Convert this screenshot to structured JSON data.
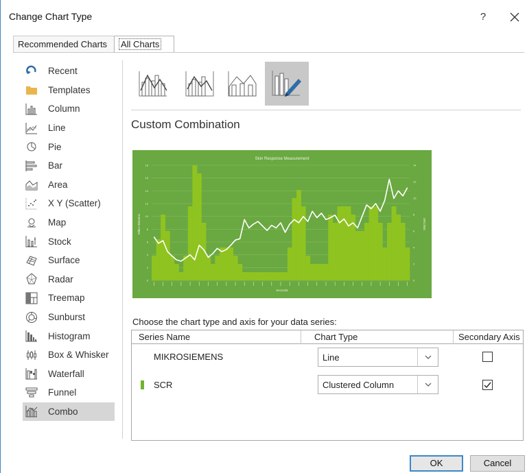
{
  "dialog": {
    "title": "Change Chart Type",
    "help": "?",
    "close": "✕"
  },
  "tabs": [
    {
      "label": "Recommended Charts"
    },
    {
      "label": "All Charts",
      "selected": true
    }
  ],
  "sidebar": {
    "items": [
      {
        "label": "Recent",
        "icon": "recent-icon"
      },
      {
        "label": "Templates",
        "icon": "templates-folder-icon"
      },
      {
        "label": "Column",
        "icon": "column-chart-icon"
      },
      {
        "label": "Line",
        "icon": "line-chart-icon"
      },
      {
        "label": "Pie",
        "icon": "pie-chart-icon"
      },
      {
        "label": "Bar",
        "icon": "bar-chart-icon"
      },
      {
        "label": "Area",
        "icon": "area-chart-icon"
      },
      {
        "label": "X Y (Scatter)",
        "icon": "scatter-chart-icon"
      },
      {
        "label": "Map",
        "icon": "map-chart-icon"
      },
      {
        "label": "Stock",
        "icon": "stock-chart-icon"
      },
      {
        "label": "Surface",
        "icon": "surface-chart-icon"
      },
      {
        "label": "Radar",
        "icon": "radar-chart-icon"
      },
      {
        "label": "Treemap",
        "icon": "treemap-chart-icon"
      },
      {
        "label": "Sunburst",
        "icon": "sunburst-chart-icon"
      },
      {
        "label": "Histogram",
        "icon": "histogram-chart-icon"
      },
      {
        "label": "Box & Whisker",
        "icon": "box-whisker-chart-icon"
      },
      {
        "label": "Waterfall",
        "icon": "waterfall-chart-icon"
      },
      {
        "label": "Funnel",
        "icon": "funnel-chart-icon"
      },
      {
        "label": "Combo",
        "icon": "combo-chart-icon",
        "selected": true
      }
    ]
  },
  "combo_variants": [
    {
      "name": "clustered-column-line",
      "selected": false
    },
    {
      "name": "clustered-column-line-secondary-axis",
      "selected": false
    },
    {
      "name": "stacked-area-clustered-column",
      "selected": false
    },
    {
      "name": "custom-combination",
      "selected": true
    }
  ],
  "section": {
    "title": "Custom Combination"
  },
  "chart_data": {
    "type": "combo",
    "title": "Skin Response Measurement",
    "xlabel": "Seconds",
    "ylabel": "Mikro-Siemens",
    "y2label": "SRC/Min",
    "background_color": "#6aa841",
    "ylim": [
      0,
      18
    ],
    "y2lim": [
      0,
      14
    ],
    "y_ticks": [
      "0",
      "2",
      "4",
      "6",
      "8",
      "10",
      "12",
      "14",
      "16",
      "18"
    ],
    "y2_ticks": [
      "0",
      "2",
      "4",
      "6",
      "8",
      "10",
      "12",
      "14"
    ],
    "series": [
      {
        "name": "SCR",
        "type": "column",
        "axis": "secondary",
        "color": "#8fc320",
        "values": [
          3,
          5,
          8,
          6,
          3,
          2,
          1,
          3,
          9,
          14,
          13,
          7,
          3,
          2,
          3,
          4,
          4,
          4,
          3,
          2,
          1,
          1,
          1,
          1,
          1,
          1,
          1,
          1,
          1,
          1,
          4,
          10,
          11,
          9,
          3,
          2,
          2,
          2,
          2,
          8,
          7,
          9,
          9,
          9,
          8,
          6,
          6,
          7,
          9,
          9,
          7,
          4,
          7,
          9,
          8,
          7,
          4
        ]
      },
      {
        "name": "MIKROSIEMENS",
        "type": "line",
        "axis": "primary",
        "color": "#ffffff",
        "values": [
          6.8,
          5.8,
          6.2,
          4.5,
          3.8,
          3.2,
          3.0,
          3.5,
          4.0,
          3.2,
          5.5,
          4.8,
          3.6,
          4.2,
          5.0,
          4.5,
          4.8,
          5.5,
          6.3,
          6.5,
          9.5,
          8.2,
          8.8,
          9.2,
          8.5,
          7.8,
          8.6,
          8.2,
          9.0,
          7.5,
          8.8,
          9.5,
          9.0,
          10.0,
          9.2,
          10.8,
          9.8,
          10.5,
          9.5,
          9.8,
          10.2,
          9.0,
          9.6,
          8.5,
          9.0,
          8.2,
          10.0,
          11.8,
          11.2,
          12.0,
          10.8,
          12.5,
          15.8,
          12.8,
          14.0,
          13.2,
          14.5
        ]
      }
    ]
  },
  "series_table": {
    "heading": "Choose the chart type and axis for your data series:",
    "columns": [
      "Series Name",
      "Chart Type",
      "Secondary Axis"
    ],
    "rows": [
      {
        "name": "MIKROSIEMENS",
        "chart_type": "Line",
        "secondary_axis": false,
        "swatch": false
      },
      {
        "name": "SCR",
        "chart_type": "Clustered Column",
        "secondary_axis": true,
        "swatch": true,
        "swatch_color": "#6fb52d"
      }
    ]
  },
  "buttons": {
    "ok": "OK",
    "cancel": "Cancel"
  }
}
